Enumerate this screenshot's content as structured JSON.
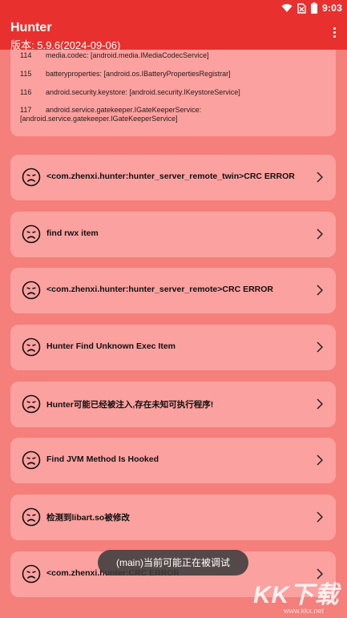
{
  "status": {
    "time": "9:03",
    "icons": [
      "wifi-icon",
      "no-sim-icon",
      "battery-icon"
    ]
  },
  "app": {
    "title": "Hunter",
    "version": "版本: 5.9.6(2024-09-06)"
  },
  "log_lines": [
    {
      "num": "114",
      "text": "media.codec: [android.media.IMediaCodecService]"
    },
    {
      "num": "115",
      "text": "batteryproperties: [android.os.IBatteryPropertiesRegistrar]"
    },
    {
      "num": "116",
      "text": "android.security.keystore: [android.security.IKeystoreService]"
    },
    {
      "num": "117",
      "text": "android.service.gatekeeper.IGateKeeperService: [android.service.gatekeeper.IGateKeeperService]"
    }
  ],
  "items": [
    {
      "label": "<com.zhenxi.hunter:hunter_server_remote_twin>CRC ERROR"
    },
    {
      "label": "find rwx item"
    },
    {
      "label": "<com.zhenxi.hunter:hunter_server_remote>CRC ERROR"
    },
    {
      "label": "Hunter Find Unknown Exec Item"
    },
    {
      "label": "Hunter可能已经被注入,存在未知可执行程序!"
    },
    {
      "label": "Find JVM Method Is Hooked"
    },
    {
      "label": "检测到libart.so被修改"
    },
    {
      "label": "<com.zhenxi.hunter:CRC ERROR"
    }
  ],
  "toast": "(main)当前可能正在被调试",
  "watermark": {
    "text": "KK下载",
    "url": "www.kkx.net"
  },
  "colors": {
    "accent": "#e8312f",
    "background": "#f47f7b",
    "card": "#fba19f"
  }
}
